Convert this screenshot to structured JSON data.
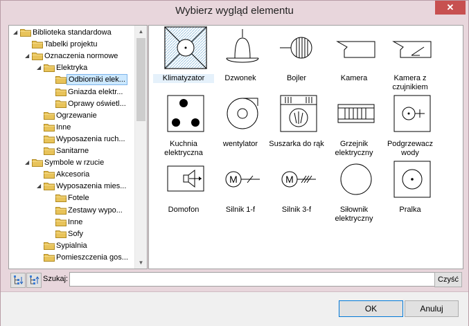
{
  "window": {
    "title": "Wybierz wygląd elementu",
    "close": "✕"
  },
  "tree": [
    {
      "label": "Biblioteka standardowa",
      "expander": "◢"
    },
    {
      "label": "Tabelki projektu",
      "expander": ""
    },
    {
      "label": "Oznaczenia normowe",
      "expander": "◢"
    },
    {
      "label": "Elektryka",
      "expander": "◢"
    },
    {
      "label": "Odbiorniki elek...",
      "expander": "",
      "selected": true
    },
    {
      "label": "Gniazda elektr...",
      "expander": ""
    },
    {
      "label": "Oprawy oświetl...",
      "expander": ""
    },
    {
      "label": "Ogrzewanie",
      "expander": ""
    },
    {
      "label": "Inne",
      "expander": ""
    },
    {
      "label": "Wyposazenia ruch...",
      "expander": ""
    },
    {
      "label": "Sanitarne",
      "expander": ""
    },
    {
      "label": "Symbole w rzucie",
      "expander": "◢"
    },
    {
      "label": "Akcesoria",
      "expander": ""
    },
    {
      "label": "Wyposazenia mies...",
      "expander": "◢"
    },
    {
      "label": "Fotele",
      "expander": ""
    },
    {
      "label": "Zestawy wypo...",
      "expander": ""
    },
    {
      "label": "Inne",
      "expander": ""
    },
    {
      "label": "Sofy",
      "expander": ""
    },
    {
      "label": "Sypialnia",
      "expander": ""
    },
    {
      "label": "Pomieszczenia gos...",
      "expander": ""
    }
  ],
  "symbols": [
    {
      "label": "Klimatyzator",
      "icon": "air-conditioner-icon",
      "selected": true
    },
    {
      "label": "Dzwonek",
      "icon": "bell-icon"
    },
    {
      "label": "Bojler",
      "icon": "boiler-icon"
    },
    {
      "label": "Kamera",
      "icon": "camera-icon"
    },
    {
      "label": "Kamera z czujnikiem",
      "icon": "camera-sensor-icon"
    },
    {
      "label": "Kuchnia elektryczna",
      "icon": "electric-stove-icon"
    },
    {
      "label": "wentylator",
      "icon": "fan-icon"
    },
    {
      "label": "Suszarka do rąk",
      "icon": "hand-dryer-icon"
    },
    {
      "label": "Grzejnik elektryczny",
      "icon": "electric-heater-icon"
    },
    {
      "label": "Podgrzewacz wody",
      "icon": "water-heater-icon"
    },
    {
      "label": "Domofon",
      "icon": "intercom-icon"
    },
    {
      "label": "Silnik 1-f",
      "icon": "motor-1f-icon"
    },
    {
      "label": "Silnik 3-f",
      "icon": "motor-3f-icon"
    },
    {
      "label": "Siłownik elektryczny",
      "icon": "electric-actuator-icon"
    },
    {
      "label": "Pralka",
      "icon": "washing-machine-icon"
    }
  ],
  "search": {
    "label": "Szukaj:",
    "value": "",
    "clear": "Czyść"
  },
  "buttons": {
    "ok": "OK",
    "cancel": "Anuluj"
  },
  "motor_letter": "M"
}
